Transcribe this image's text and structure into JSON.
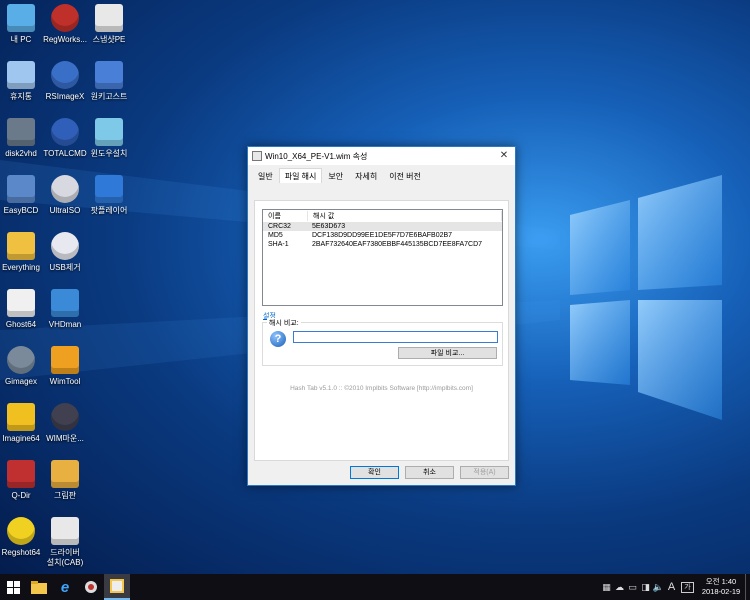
{
  "desktop_icons": [
    {
      "label": "내 PC",
      "icon": "computer-icon"
    },
    {
      "label": "RegWorks...",
      "icon": "regworks-icon"
    },
    {
      "label": "스냅샷PE",
      "icon": "snapshot-icon"
    },
    {
      "label": "휴지통",
      "icon": "recycle-bin-icon"
    },
    {
      "label": "RSImageX",
      "icon": "rsimagex-icon"
    },
    {
      "label": "원키고스트",
      "icon": "onekey-ghost-icon"
    },
    {
      "label": "disk2vhd",
      "icon": "disk2vhd-icon"
    },
    {
      "label": "TOTALCMD",
      "icon": "floppy-icon"
    },
    {
      "label": "윈도우설치",
      "icon": "windows-setup-icon"
    },
    {
      "label": "EasyBCD",
      "icon": "easybcd-icon"
    },
    {
      "label": "UltraISO",
      "icon": "disc-icon"
    },
    {
      "label": "팟플레이어",
      "icon": "potplayer-icon"
    },
    {
      "label": "Everything",
      "icon": "magnifier-icon"
    },
    {
      "label": "USB제거",
      "icon": "usb-icon"
    },
    {
      "label": "Ghost64",
      "icon": "ghost-icon"
    },
    {
      "label": "VHDman",
      "icon": "vhdman-icon"
    },
    {
      "label": "Gimagex",
      "icon": "gimagex-icon"
    },
    {
      "label": "WimTool",
      "icon": "wimtool-icon"
    },
    {
      "label": "Imagine64",
      "icon": "imagine-icon"
    },
    {
      "label": "WIM마운...",
      "icon": "wim-mount-icon"
    },
    {
      "label": "Q-Dir",
      "icon": "qdir-icon"
    },
    {
      "label": "그림판",
      "icon": "paint-icon"
    },
    {
      "label": "Regshot64",
      "icon": "regshot-icon"
    },
    {
      "label": "드라이버",
      "label2": "설치(CAB)",
      "icon": "driver-ghost-icon"
    }
  ],
  "dialog": {
    "title": "Win10_X64_PE-V1.wim 속성",
    "tabs": [
      "일반",
      "파일 해시",
      "보안",
      "자세히",
      "이전 버전"
    ],
    "active_tab": "파일 해시",
    "list_headers": [
      "이름",
      "해시 값"
    ],
    "hash_rows": [
      {
        "name": "CRC32",
        "value": "5E63D673"
      },
      {
        "name": "MD5",
        "value": "DCF138D9DD99EE1DE5F7D7E6BAFB02B7"
      },
      {
        "name": "SHA-1",
        "value": "2BAF732640EAF7380EBBF445135BCD7EE8FA7CD7"
      }
    ],
    "settings_link": "설정",
    "compare_group_title": "해시 비교:",
    "compare_input_value": "",
    "file_compare_button": "파일 비교...",
    "credit": "Hash Tab v5.1.0 :: ©2010 Implbits Software [http://implbits.com]",
    "ok_button": "확인",
    "cancel_button": "취소",
    "apply_button": "적용(A)"
  },
  "taskbar": {
    "clock_time": "오전 1:40",
    "clock_date": "2018-02-19",
    "ime_label": "A",
    "ime_mode": "가"
  },
  "colors": {
    "accent": "#0078d7",
    "desktop_bg": "#0a3a80",
    "taskbar_bg": "#0e0e14"
  }
}
